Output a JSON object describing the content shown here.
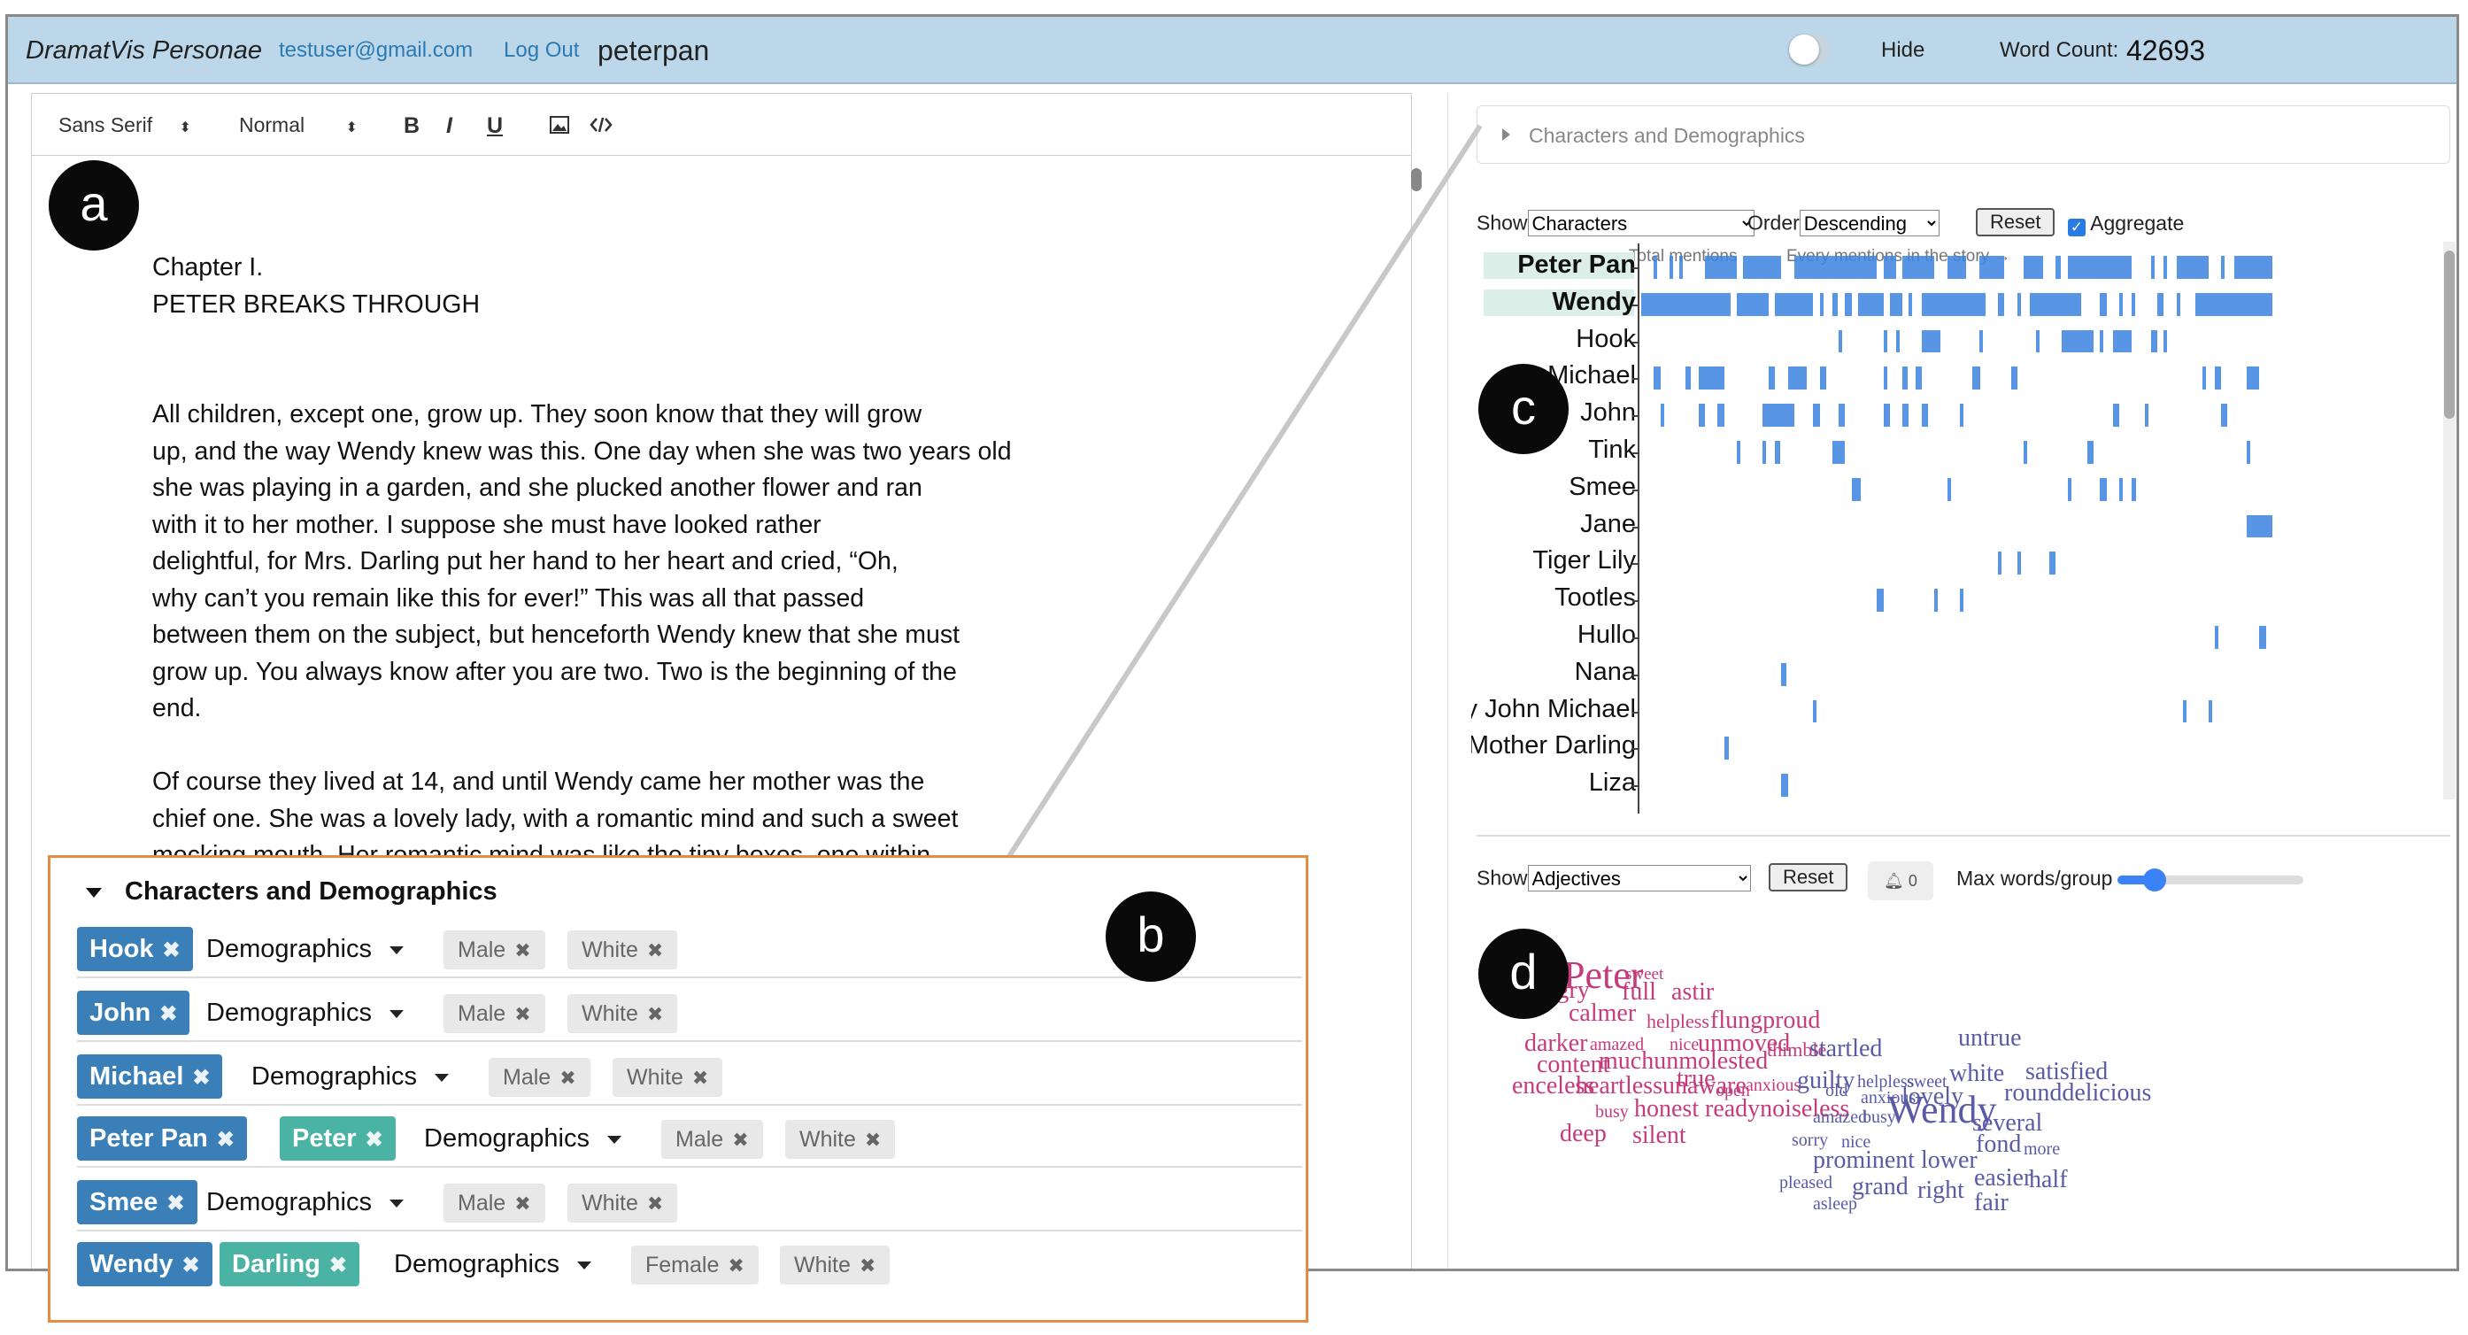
{
  "header": {
    "brand": "DramatVis Personae",
    "email": "testuser@gmail.com",
    "logout": "Log Out",
    "project": "peterpan",
    "hide_label": "Hide",
    "word_count_label": "Word Count:",
    "word_count": "42693"
  },
  "toolbar": {
    "font": "Sans Serif",
    "size": "Normal",
    "bold": "B",
    "italic": "I",
    "underline": "U"
  },
  "editor": {
    "heading1": "Chapter I.",
    "heading2": "PETER BREAKS THROUGH",
    "lines1": [
      "All children, except one, grow up. They soon know that they will grow",
      "up, and the way Wendy knew was this. One day when she was two years old",
      "she was playing in a garden, and she plucked another flower and ran",
      "with it to her mother. I suppose she must have looked rather",
      "delightful, for Mrs. Darling put her hand to her heart and cried, “Oh,",
      "why can’t you remain like this for ever!” This was all that passed",
      "between them on the subject, but henceforth Wendy knew that she must",
      "grow up. You always know after you are two. Two is the beginning of the",
      "end."
    ],
    "lines2": [
      "Of course they lived at 14, and until Wendy came her mother was the",
      "chief one. She was a lovely lady, with a romantic mind and such a sweet",
      "mocking mouth. Her romantic mind was like the tiny boxes, one within"
    ]
  },
  "labels": {
    "a": "a",
    "b": "b",
    "c": "c",
    "d": "d"
  },
  "right": {
    "accordion": "Characters and Demographics",
    "show_label": "Show",
    "show_value": "Characters",
    "order_label": "Order",
    "order_value": "Descending",
    "reset": "Reset",
    "aggregate": "Aggregate",
    "hint_total": "← Total mentions",
    "hint_every": "Every mentions in the story →",
    "show2_value": "Adjectives",
    "bell_count": "0",
    "max_words": "Max words/group",
    "max_words_level": 0.2
  },
  "chart_data": {
    "type": "heatmap",
    "title": "",
    "y_categories": [
      "Peter Pan",
      "Wendy",
      "Hook",
      "Michael",
      "John",
      "Tink",
      "Smee",
      "Jane",
      "Tiger Lily",
      "Tootles",
      "Hullo",
      "Nana",
      "Wendy John Michael",
      "Mother Darling",
      "Liza"
    ],
    "x_range": [
      0,
      1
    ],
    "colors": {
      "mention": "#3b82e0",
      "highlight": "#dbeee8"
    },
    "series": [
      {
        "values": [
          [
            0.02,
            0.004
          ],
          [
            0.045,
            0.004
          ],
          [
            0.06,
            0.003
          ],
          [
            0.1,
            0.05
          ],
          [
            0.16,
            0.06
          ],
          [
            0.24,
            0.13
          ],
          [
            0.38,
            0.02
          ],
          [
            0.41,
            0.05
          ],
          [
            0.48,
            0.03
          ],
          [
            0.53,
            0.04
          ],
          [
            0.6,
            0.03
          ],
          [
            0.65,
            0.008
          ],
          [
            0.67,
            0.1
          ],
          [
            0.8,
            0.004
          ],
          [
            0.82,
            0.004
          ],
          [
            0.84,
            0.05
          ],
          [
            0.91,
            0.004
          ],
          [
            0.93,
            0.06
          ]
        ]
      },
      {
        "values": [
          [
            0.0,
            0.14
          ],
          [
            0.15,
            0.05
          ],
          [
            0.21,
            0.06
          ],
          [
            0.28,
            0.005
          ],
          [
            0.3,
            0.008
          ],
          [
            0.32,
            0.01
          ],
          [
            0.34,
            0.04
          ],
          [
            0.39,
            0.02
          ],
          [
            0.42,
            0.005
          ],
          [
            0.44,
            0.1
          ],
          [
            0.56,
            0.01
          ],
          [
            0.59,
            0.005
          ],
          [
            0.61,
            0.08
          ],
          [
            0.72,
            0.01
          ],
          [
            0.75,
            0.004
          ],
          [
            0.77,
            0.004
          ],
          [
            0.81,
            0.01
          ],
          [
            0.84,
            0.004
          ],
          [
            0.87,
            0.03
          ],
          [
            0.9,
            0.09
          ]
        ]
      },
      {
        "values": [
          [
            0.31,
            0.004
          ],
          [
            0.38,
            0.005
          ],
          [
            0.4,
            0.004
          ],
          [
            0.44,
            0.03
          ],
          [
            0.53,
            0.005
          ],
          [
            0.62,
            0.005
          ],
          [
            0.66,
            0.04
          ],
          [
            0.72,
            0.004
          ],
          [
            0.7,
            0.01
          ],
          [
            0.74,
            0.03
          ],
          [
            0.8,
            0.01
          ],
          [
            0.82,
            0.004
          ]
        ]
      },
      {
        "values": [
          [
            0.02,
            0.01
          ],
          [
            0.07,
            0.008
          ],
          [
            0.09,
            0.04
          ],
          [
            0.2,
            0.01
          ],
          [
            0.23,
            0.03
          ],
          [
            0.28,
            0.01
          ],
          [
            0.38,
            0.006
          ],
          [
            0.41,
            0.008
          ],
          [
            0.43,
            0.01
          ],
          [
            0.52,
            0.012
          ],
          [
            0.58,
            0.01
          ],
          [
            0.88,
            0.004
          ],
          [
            0.9,
            0.01
          ],
          [
            0.95,
            0.02
          ]
        ]
      },
      {
        "values": [
          [
            0.03,
            0.004
          ],
          [
            0.09,
            0.01
          ],
          [
            0.12,
            0.01
          ],
          [
            0.19,
            0.05
          ],
          [
            0.27,
            0.01
          ],
          [
            0.31,
            0.01
          ],
          [
            0.38,
            0.01
          ],
          [
            0.41,
            0.01
          ],
          [
            0.44,
            0.01
          ],
          [
            0.5,
            0.006
          ],
          [
            0.74,
            0.01
          ],
          [
            0.79,
            0.006
          ],
          [
            0.91,
            0.01
          ]
        ]
      },
      {
        "values": [
          [
            0.15,
            0.004
          ],
          [
            0.19,
            0.006
          ],
          [
            0.21,
            0.008
          ],
          [
            0.3,
            0.02
          ],
          [
            0.6,
            0.005
          ],
          [
            0.7,
            0.01
          ],
          [
            0.95,
            0.004
          ]
        ]
      },
      {
        "values": [
          [
            0.33,
            0.015
          ],
          [
            0.48,
            0.005
          ],
          [
            0.67,
            0.004
          ],
          [
            0.72,
            0.01
          ],
          [
            0.75,
            0.004
          ],
          [
            0.77,
            0.006
          ]
        ]
      },
      {
        "values": [
          [
            0.95,
            0.04
          ]
        ]
      },
      {
        "values": [
          [
            0.56,
            0.004
          ],
          [
            0.59,
            0.004
          ],
          [
            0.64,
            0.01
          ]
        ]
      },
      {
        "values": [
          [
            0.37,
            0.01
          ],
          [
            0.46,
            0.005
          ],
          [
            0.5,
            0.004
          ]
        ]
      },
      {
        "values": [
          [
            0.9,
            0.004
          ],
          [
            0.97,
            0.01
          ]
        ]
      },
      {
        "values": [
          [
            0.22,
            0.008
          ]
        ]
      },
      {
        "values": [
          [
            0.27,
            0.004
          ],
          [
            0.85,
            0.004
          ],
          [
            0.89,
            0.004
          ]
        ]
      },
      {
        "values": [
          [
            0.13,
            0.008
          ]
        ]
      },
      {
        "values": [
          [
            0.22,
            0.01
          ]
        ]
      }
    ]
  },
  "wordcloud": [
    {
      "t": "Peter",
      "x": 130,
      "y": 1092,
      "s": 44,
      "c": "#c53b7c"
    },
    {
      "t": "full",
      "x": 196,
      "y": 1108,
      "s": 28,
      "c": "#c53b7c"
    },
    {
      "t": "sweet",
      "x": 200,
      "y": 1086,
      "s": 19,
      "c": "#c53b7c"
    },
    {
      "t": "astir",
      "x": 252,
      "y": 1108,
      "s": 28,
      "c": "#c53b7c"
    },
    {
      "t": "angry",
      "x": 96,
      "y": 1106,
      "s": 28,
      "c": "#c53b7c"
    },
    {
      "t": "calmer",
      "x": 136,
      "y": 1132,
      "s": 28,
      "c": "#c53b7c"
    },
    {
      "t": "helpless",
      "x": 224,
      "y": 1140,
      "s": 22,
      "c": "#c53b7c"
    },
    {
      "t": "flungproud",
      "x": 296,
      "y": 1140,
      "s": 28,
      "c": "#c53b7c"
    },
    {
      "t": "darker",
      "x": 86,
      "y": 1166,
      "s": 28,
      "c": "#c53b7c"
    },
    {
      "t": "amazed",
      "x": 160,
      "y": 1166,
      "s": 20,
      "c": "#c53b7c"
    },
    {
      "t": "nice",
      "x": 250,
      "y": 1166,
      "s": 20,
      "c": "#c53b7c"
    },
    {
      "t": "unmoved",
      "x": 282,
      "y": 1166,
      "s": 28,
      "c": "#c53b7c"
    },
    {
      "t": "thimble",
      "x": 360,
      "y": 1172,
      "s": 22,
      "c": "#c53b7c"
    },
    {
      "t": "content",
      "x": 100,
      "y": 1190,
      "s": 28,
      "c": "#c53b7c"
    },
    {
      "t": "muchunmolested",
      "x": 170,
      "y": 1186,
      "s": 28,
      "c": "#c53b7c"
    },
    {
      "t": "true",
      "x": 258,
      "y": 1206,
      "s": 28,
      "c": "#c53b7c"
    },
    {
      "t": "open",
      "x": 302,
      "y": 1218,
      "s": 20,
      "c": "#c53b7c"
    },
    {
      "t": "anxious",
      "x": 336,
      "y": 1212,
      "s": 20,
      "c": "#c53b7c"
    },
    {
      "t": "enceless",
      "x": 72,
      "y": 1214,
      "s": 28,
      "c": "#c53b7c"
    },
    {
      "t": "heartlessunaware",
      "x": 144,
      "y": 1214,
      "s": 28,
      "c": "#c53b7c"
    },
    {
      "t": "busy",
      "x": 166,
      "y": 1242,
      "s": 20,
      "c": "#c53b7c"
    },
    {
      "t": "honest",
      "x": 210,
      "y": 1240,
      "s": 28,
      "c": "#c53b7c"
    },
    {
      "t": "readynoiseless",
      "x": 290,
      "y": 1240,
      "s": 28,
      "c": "#c53b7c"
    },
    {
      "t": "deep",
      "x": 126,
      "y": 1268,
      "s": 28,
      "c": "#c53b7c"
    },
    {
      "t": "silent",
      "x": 208,
      "y": 1270,
      "s": 28,
      "c": "#c53b7c"
    },
    {
      "t": "startled",
      "x": 408,
      "y": 1172,
      "s": 28,
      "c": "#5a5aa6"
    },
    {
      "t": "untrue",
      "x": 576,
      "y": 1160,
      "s": 28,
      "c": "#5a5aa6"
    },
    {
      "t": "guilty",
      "x": 394,
      "y": 1208,
      "s": 28,
      "c": "#5a5aa6"
    },
    {
      "t": "old",
      "x": 426,
      "y": 1218,
      "s": 20,
      "c": "#5a5aa6"
    },
    {
      "t": "helpless",
      "x": 462,
      "y": 1208,
      "s": 20,
      "c": "#5a5aa6"
    },
    {
      "t": "sweet",
      "x": 518,
      "y": 1208,
      "s": 20,
      "c": "#5a5aa6"
    },
    {
      "t": "white",
      "x": 566,
      "y": 1200,
      "s": 28,
      "c": "#5a5aa6"
    },
    {
      "t": "satisfied",
      "x": 652,
      "y": 1198,
      "s": 28,
      "c": "#5a5aa6"
    },
    {
      "t": "anxious",
      "x": 466,
      "y": 1226,
      "s": 20,
      "c": "#5a5aa6"
    },
    {
      "t": "lovely",
      "x": 512,
      "y": 1226,
      "s": 28,
      "c": "#5a5aa6"
    },
    {
      "t": "rounddelicious",
      "x": 628,
      "y": 1222,
      "s": 28,
      "c": "#5a5aa6"
    },
    {
      "t": "amazed",
      "x": 412,
      "y": 1248,
      "s": 20,
      "c": "#5a5aa6"
    },
    {
      "t": "busy",
      "x": 468,
      "y": 1248,
      "s": 20,
      "c": "#5a5aa6"
    },
    {
      "t": "Wendy",
      "x": 496,
      "y": 1244,
      "s": 44,
      "c": "#5a5aa6"
    },
    {
      "t": "several",
      "x": 592,
      "y": 1256,
      "s": 28,
      "c": "#5a5aa6"
    },
    {
      "t": "sorry",
      "x": 388,
      "y": 1274,
      "s": 20,
      "c": "#5a5aa6"
    },
    {
      "t": "nice",
      "x": 444,
      "y": 1276,
      "s": 20,
      "c": "#5a5aa6"
    },
    {
      "t": "fond",
      "x": 596,
      "y": 1280,
      "s": 28,
      "c": "#5a5aa6"
    },
    {
      "t": "more",
      "x": 650,
      "y": 1284,
      "s": 20,
      "c": "#5a5aa6"
    },
    {
      "t": "prominent",
      "x": 412,
      "y": 1298,
      "s": 28,
      "c": "#5a5aa6"
    },
    {
      "t": "lower",
      "x": 534,
      "y": 1298,
      "s": 28,
      "c": "#5a5aa6"
    },
    {
      "t": "easier",
      "x": 594,
      "y": 1318,
      "s": 28,
      "c": "#5a5aa6"
    },
    {
      "t": "half",
      "x": 656,
      "y": 1320,
      "s": 28,
      "c": "#5a5aa6"
    },
    {
      "t": "pleased",
      "x": 374,
      "y": 1322,
      "s": 20,
      "c": "#5a5aa6"
    },
    {
      "t": "grand",
      "x": 456,
      "y": 1328,
      "s": 28,
      "c": "#5a5aa6"
    },
    {
      "t": "right",
      "x": 530,
      "y": 1332,
      "s": 28,
      "c": "#5a5aa6"
    },
    {
      "t": "fair",
      "x": 594,
      "y": 1346,
      "s": 28,
      "c": "#5a5aa6"
    },
    {
      "t": "asleep",
      "x": 412,
      "y": 1346,
      "s": 20,
      "c": "#5a5aa6"
    }
  ],
  "panel_b": {
    "title": "Characters and Demographics",
    "demographics": "Demographics",
    "rows": [
      {
        "names": [
          {
            "n": "Hook",
            "c": "blue"
          }
        ],
        "chips": [
          "Male",
          "White"
        ]
      },
      {
        "names": [
          {
            "n": "John",
            "c": "blue"
          }
        ],
        "chips": [
          "Male",
          "White"
        ]
      },
      {
        "names": [
          {
            "n": "Michael",
            "c": "blue"
          }
        ],
        "chips": [
          "Male",
          "White"
        ]
      },
      {
        "names": [
          {
            "n": "Peter Pan",
            "c": "blue"
          },
          {
            "n": "Peter",
            "c": "teal"
          }
        ],
        "chips": [
          "Male",
          "White"
        ]
      },
      {
        "names": [
          {
            "n": "Smee",
            "c": "blue"
          }
        ],
        "chips": [
          "Male",
          "White"
        ]
      },
      {
        "names": [
          {
            "n": "Wendy",
            "c": "blue"
          },
          {
            "n": "Darling",
            "c": "teal"
          }
        ],
        "chips": [
          "Female",
          "White"
        ]
      }
    ]
  }
}
